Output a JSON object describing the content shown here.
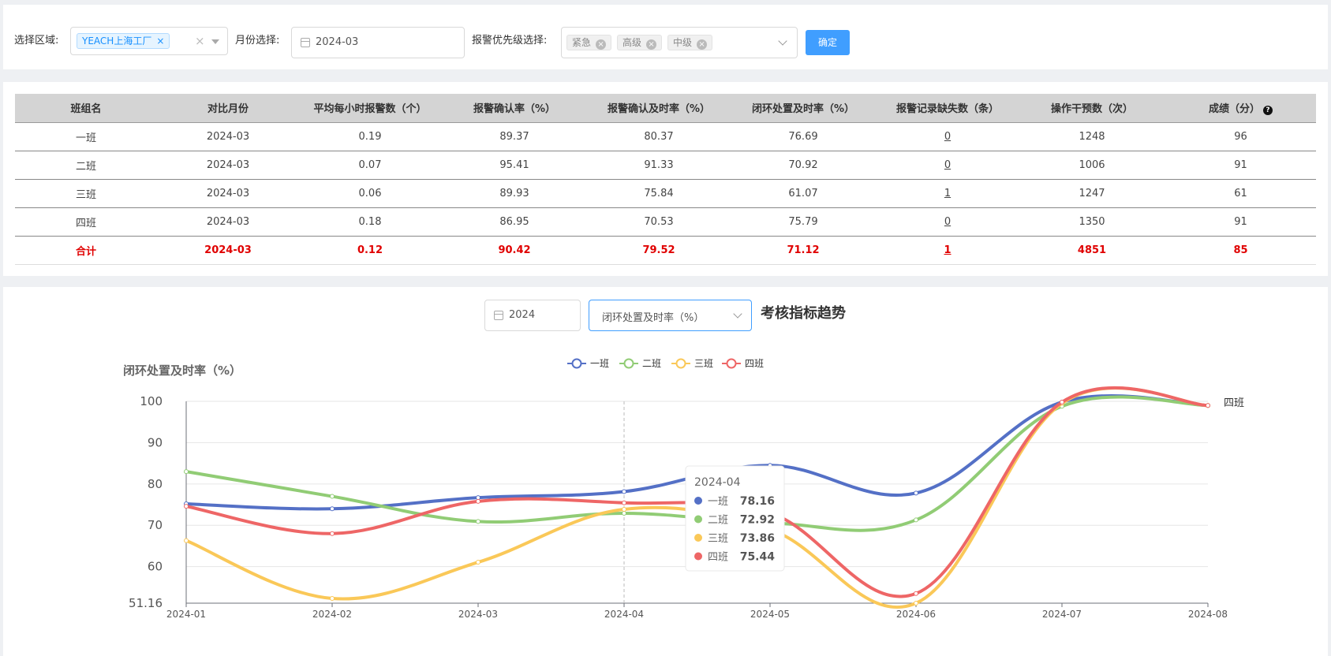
{
  "filters": {
    "region_label": "选择区域:",
    "region_tag": "YEACH上海工厂",
    "month_label": "月份选择:",
    "month_value": "2024-03",
    "priority_label": "报警优先级选择:",
    "priority_tags": [
      "紧急",
      "高级",
      "中级"
    ],
    "confirm_label": "确定"
  },
  "table": {
    "headers": [
      "班组名",
      "对比月份",
      "平均每小时报警数（个）",
      "报警确认率（%）",
      "报警确认及时率（%）",
      "闭环处置及时率（%）",
      "报警记录缺失数（条）",
      "操作干预数（次）",
      "成绩（分）"
    ],
    "rows": [
      [
        "一班",
        "2024-03",
        "0.19",
        "89.37",
        "80.37",
        "76.69",
        "0",
        "1248",
        "96"
      ],
      [
        "二班",
        "2024-03",
        "0.07",
        "95.41",
        "91.33",
        "70.92",
        "0",
        "1006",
        "91"
      ],
      [
        "三班",
        "2024-03",
        "0.06",
        "89.93",
        "75.84",
        "61.07",
        "1",
        "1247",
        "61"
      ],
      [
        "四班",
        "2024-03",
        "0.18",
        "86.95",
        "70.53",
        "75.79",
        "0",
        "1350",
        "91"
      ]
    ],
    "total": [
      "合计",
      "2024-03",
      "0.12",
      "90.42",
      "79.52",
      "71.12",
      "1",
      "4851",
      "85"
    ]
  },
  "trend": {
    "year_value": "2024",
    "metric_value": "闭环处置及时率（%）",
    "title": "考核指标趋势"
  },
  "chart_data": {
    "type": "line",
    "ylabel": "闭环处置及时率（%）",
    "ylim": [
      51.16,
      100
    ],
    "yticks": [
      "51.16",
      "60",
      "70",
      "80",
      "90",
      "100"
    ],
    "x": [
      "2024-01",
      "2024-02",
      "2024-03",
      "2024-04",
      "2024-05",
      "2024-06",
      "2024-07",
      "2024-08"
    ],
    "legend_position": "top-center",
    "end_label": "四班",
    "series": [
      {
        "name": "一班",
        "color": "#5470c6",
        "values": [
          75.2,
          74.0,
          76.69,
          78.16,
          84.5,
          77.8,
          99.8,
          99.0
        ]
      },
      {
        "name": "二班",
        "color": "#91cc75",
        "values": [
          83.0,
          77.0,
          70.92,
          72.92,
          70.6,
          71.3,
          98.8,
          99.0
        ]
      },
      {
        "name": "三班",
        "color": "#fac858",
        "values": [
          66.3,
          52.3,
          61.07,
          73.86,
          69.0,
          51.16,
          99.5,
          99.0
        ]
      },
      {
        "name": "四班",
        "color": "#ee6666",
        "values": [
          74.6,
          68.0,
          75.79,
          75.44,
          73.0,
          53.5,
          99.8,
          99.0
        ]
      }
    ],
    "tooltip": {
      "category": "2024-04",
      "values": [
        "78.16",
        "72.92",
        "73.86",
        "75.44"
      ]
    }
  }
}
